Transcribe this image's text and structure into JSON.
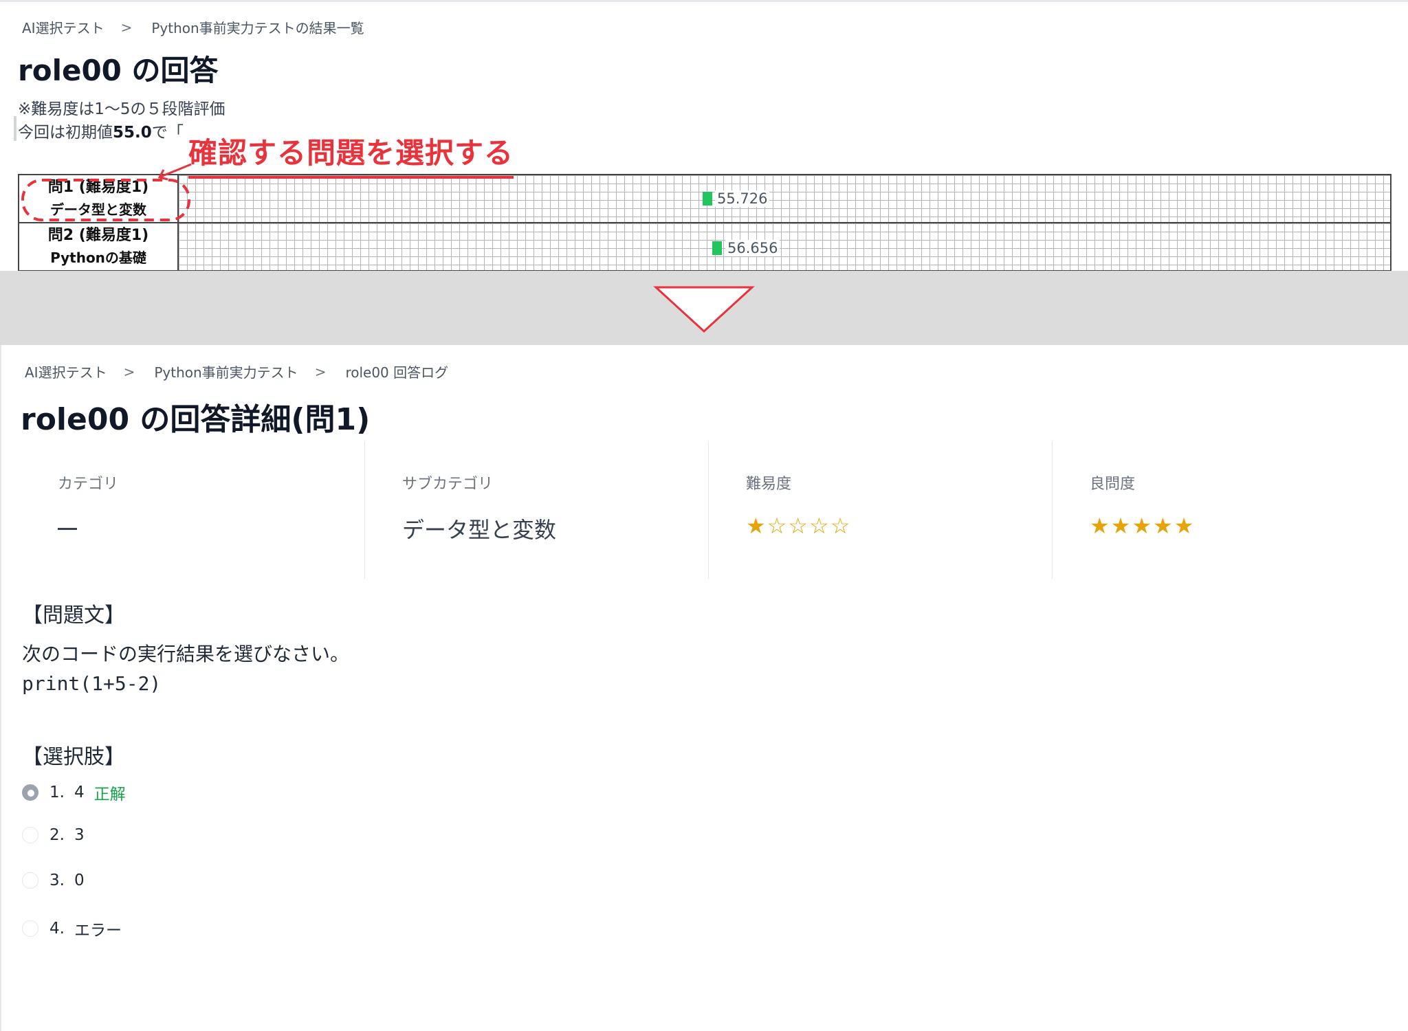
{
  "top": {
    "breadcrumb": [
      "AI選択テスト",
      "Python事前実力テストの結果一覧"
    ],
    "breadcrumb_sep": ">",
    "title": "role00 の回答",
    "note1": "※難易度は1～5の５段階評価",
    "note2_prefix": "今回は初期値",
    "note2_value": "55.0",
    "note2_suffix": "で「",
    "annotation": "確認する問題を選択する",
    "rows": [
      {
        "label": "問1 (難易度1)",
        "sub": "データ型と変数",
        "value": "55.726"
      },
      {
        "label": "問2 (難易度1)",
        "sub": "Pythonの基礎",
        "value": "56.656"
      }
    ]
  },
  "bottom": {
    "breadcrumb": [
      "AI選択テスト",
      "Python事前実力テスト",
      "role00 回答ログ"
    ],
    "breadcrumb_sep": ">",
    "title": "role00 の回答詳細(問1)",
    "stats": {
      "category": {
        "label": "カテゴリ",
        "value": ""
      },
      "subcategory": {
        "label": "サブカテゴリ",
        "value": "データ型と変数"
      },
      "difficulty": {
        "label": "難易度",
        "stars": "★☆☆☆☆",
        "rating": 1,
        "max": 5
      },
      "quality": {
        "label": "良問度",
        "stars": "★★★★★",
        "rating": 5,
        "max": 5
      }
    },
    "question_title": "【問題文】",
    "question_text": "次のコードの実行結果を選びなさい。",
    "question_code": "print(1+5-2)",
    "choices_title": "【選択肢】",
    "choices": [
      {
        "num": "1.",
        "text": "4",
        "badge": "正解",
        "selected": true
      },
      {
        "num": "2.",
        "text": "3",
        "badge": "",
        "selected": false
      },
      {
        "num": "3.",
        "text": "0",
        "badge": "",
        "selected": false
      },
      {
        "num": "4.",
        "text": "エラー",
        "badge": "",
        "selected": false
      }
    ]
  },
  "colors": {
    "annotation": "#e8323c",
    "bar": "#22c55e",
    "star": "#e5a50a",
    "correct": "#16a34a",
    "divider": "#dcdcdc"
  }
}
